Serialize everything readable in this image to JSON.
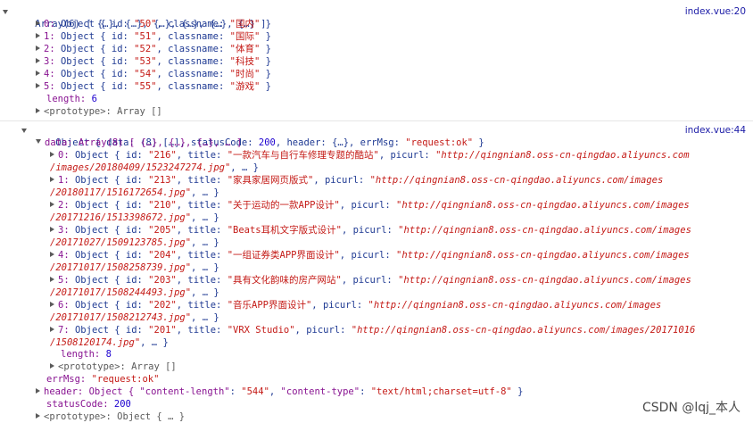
{
  "log1": {
    "source": "index.vue:20",
    "summary": "Array(6) [ {…}, {…}, {…}, {…}, {…}, {…} ]",
    "items": [
      {
        "idx": "0:",
        "id": "\"50\"",
        "classname": "\"国内\""
      },
      {
        "idx": "1:",
        "id": "\"51\"",
        "classname": "\"国际\""
      },
      {
        "idx": "2:",
        "id": "\"52\"",
        "classname": "\"体育\""
      },
      {
        "idx": "3:",
        "id": "\"53\"",
        "classname": "\"科技\""
      },
      {
        "idx": "4:",
        "id": "\"54\"",
        "classname": "\"时尚\""
      },
      {
        "idx": "5:",
        "id": "\"55\"",
        "classname": "\"游戏\""
      }
    ],
    "length_label": "length:",
    "length_value": "6",
    "prototype": "<prototype>: Array []"
  },
  "log2": {
    "source": "index.vue:44",
    "summary_prefix": "Object { data: (8) […], statusCode: ",
    "summary_status": "200",
    "summary_mid": ", header: {…}, errMsg: ",
    "summary_errmsg": "\"request:ok\"",
    "summary_suffix": " }",
    "data_label": "data: Array(8) [ {…}, {…}, {…}, … ]",
    "items": [
      {
        "idx": "0:",
        "id": "\"216\"",
        "title": "\"一款汽车与自行车修理专题的酷站\"",
        "url1": "\"http://qingnian8.oss-cn-qingdao.aliyuncs.com",
        "url2": "/images/20180409/1523247274.jpg\""
      },
      {
        "idx": "1:",
        "id": "\"213\"",
        "title": "\"家具家居网页版式\"",
        "url1": "\"http://qingnian8.oss-cn-qingdao.aliyuncs.com/images",
        "url2": "/20180117/1516172654.jpg\""
      },
      {
        "idx": "2:",
        "id": "\"210\"",
        "title": "\"关于运动的一款APP设计\"",
        "url1": "\"http://qingnian8.oss-cn-qingdao.aliyuncs.com/images",
        "url2": "/20171216/1513398672.jpg\""
      },
      {
        "idx": "3:",
        "id": "\"205\"",
        "title": "\"Beats耳机文字版式设计\"",
        "url1": "\"http://qingnian8.oss-cn-qingdao.aliyuncs.com/images",
        "url2": "/20171027/1509123785.jpg\""
      },
      {
        "idx": "4:",
        "id": "\"204\"",
        "title": "\"一组证券类APP界面设计\"",
        "url1": "\"http://qingnian8.oss-cn-qingdao.aliyuncs.com/images",
        "url2": "/20171017/1508258739.jpg\""
      },
      {
        "idx": "5:",
        "id": "\"203\"",
        "title": "\"具有文化韵味的房产网站\"",
        "url1": "\"http://qingnian8.oss-cn-qingdao.aliyuncs.com/images",
        "url2": "/20171017/1508244493.jpg\""
      },
      {
        "idx": "6:",
        "id": "\"202\"",
        "title": "\"音乐APP界面设计\"",
        "url1": "\"http://qingnian8.oss-cn-qingdao.aliyuncs.com/images",
        "url2": "/20171017/1508212743.jpg\""
      },
      {
        "idx": "7:",
        "id": "\"201\"",
        "title": "\"VRX Studio\"",
        "url1": "\"http://qingnian8.oss-cn-qingdao.aliyuncs.com/images/20171016",
        "url2": "/1508120174.jpg\""
      }
    ],
    "data_length_label": "length:",
    "data_length_value": "8",
    "data_prototype": "<prototype>: Array []",
    "errmsg_label": "errMsg:",
    "errmsg_value": "\"request:ok\"",
    "header_prefix": "header: Object { ",
    "header_k1": "\"content-length\"",
    "header_v1": "\"544\"",
    "header_k2": "\"content-type\"",
    "header_v2": "\"text/html;charset=utf-8\"",
    "header_suffix": " }",
    "status_label": "statusCode:",
    "status_value": "200",
    "prototype": "<prototype>: Object { … }"
  },
  "watermark": "CSDN @lqj_本人"
}
